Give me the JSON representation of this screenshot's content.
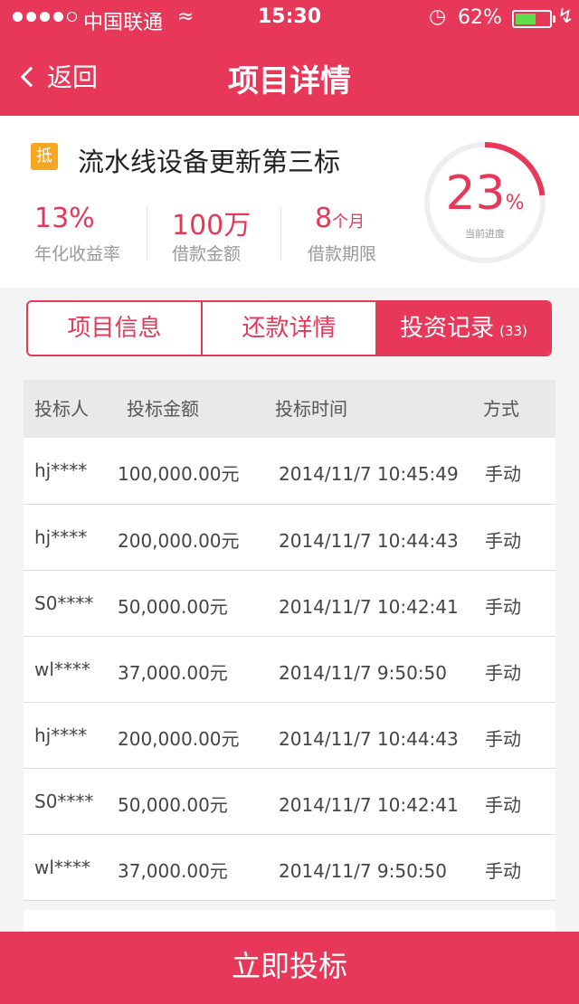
{
  "status_bar": {
    "carrier": "中国联通",
    "time": "15:30",
    "battery": "62%",
    "battery_level": 0.62
  },
  "nav": {
    "back_label": "返回",
    "title": "项目详情"
  },
  "project": {
    "tag": "抵",
    "name": "流水线设备更新第三标",
    "stats": [
      {
        "value": "13%",
        "unit": "",
        "label": "年化收益率"
      },
      {
        "value": "100万",
        "unit": "",
        "label": "借款金额"
      },
      {
        "value": "8",
        "unit": "个月",
        "label": "借款期限"
      }
    ],
    "progress": {
      "value": "23",
      "unit": "%",
      "label": "当前进度",
      "fraction": 0.23
    }
  },
  "tabs": [
    {
      "label": "项目信息",
      "count": ""
    },
    {
      "label": "还款详情",
      "count": ""
    },
    {
      "label": "投资记录",
      "count": "(33)"
    }
  ],
  "table": {
    "headers": [
      "投标人",
      "投标金额",
      "投标时间",
      "方式"
    ],
    "rows": [
      [
        "hj****",
        "100,000.00元",
        "2014/11/7 10:45:49",
        "手动"
      ],
      [
        "hj****",
        "200,000.00元",
        "2014/11/7 10:44:43",
        "手动"
      ],
      [
        "S0****",
        "50,000.00元",
        "2014/11/7 10:42:41",
        "手动"
      ],
      [
        "wl****",
        "37,000.00元",
        "2014/11/7 9:50:50",
        "手动"
      ],
      [
        "hj****",
        "200,000.00元",
        "2014/11/7 10:44:43",
        "手动"
      ],
      [
        "S0****",
        "50,000.00元",
        "2014/11/7 10:42:41",
        "手动"
      ],
      [
        "wl****",
        "37,000.00元",
        "2014/11/7 9:50:50",
        "手动"
      ]
    ]
  },
  "cta_label": "立即投标",
  "colors": {
    "accent": "#e7385a",
    "tag": "#f5a623"
  }
}
